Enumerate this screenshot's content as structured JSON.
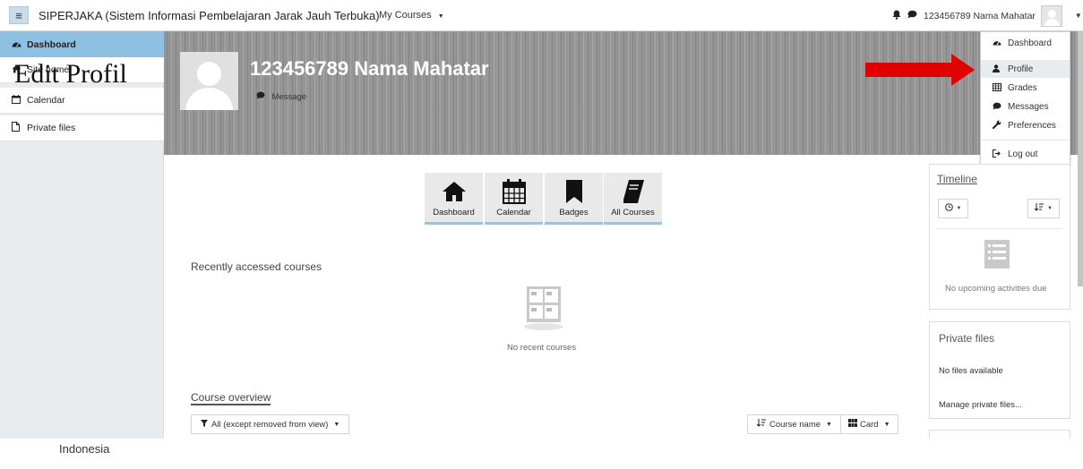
{
  "navbar": {
    "site_name": "SIPERJAKA (Sistem Informasi Pembelajaran Jarak Jauh Terbuka)",
    "my_courses": "My Courses",
    "user_name": "123456789 Nama Mahatar"
  },
  "drawer": {
    "items": [
      {
        "label": "Dashboard",
        "icon": "tachometer-icon",
        "active": true
      },
      {
        "label": "Site home",
        "icon": "home-icon"
      },
      {
        "label": "Calendar",
        "icon": "calendar-icon"
      },
      {
        "label": "Private files",
        "icon": "file-icon"
      }
    ]
  },
  "overlay_title": "Edit Profil",
  "profile": {
    "name": "123456789 Nama Mahatar",
    "message_label": "Message"
  },
  "user_menu": {
    "items": [
      {
        "label": "Dashboard",
        "icon": "tachometer-icon"
      },
      {
        "label": "Profile",
        "icon": "user-icon",
        "highlighted": true
      },
      {
        "label": "Grades",
        "icon": "table-icon"
      },
      {
        "label": "Messages",
        "icon": "comment-icon"
      },
      {
        "label": "Preferences",
        "icon": "wrench-icon"
      },
      {
        "label": "Log out",
        "icon": "sign-out-icon"
      }
    ]
  },
  "tiles": [
    {
      "label": "Dashboard",
      "icon": "home-icon"
    },
    {
      "label": "Calendar",
      "icon": "calendar-icon"
    },
    {
      "label": "Badges",
      "icon": "bookmark-icon"
    },
    {
      "label": "All Courses",
      "icon": "book-icon"
    }
  ],
  "recent": {
    "title": "Recently accessed courses",
    "empty_text": "No recent courses"
  },
  "overview": {
    "title": "Course overview",
    "filter_label": "All (except removed from view)",
    "sort_label": "Course name",
    "view_label": "Card"
  },
  "timeline": {
    "title": "Timeline",
    "empty_text": "No upcoming activities due"
  },
  "private_files": {
    "title": "Private files",
    "empty_text": "No files available",
    "manage_link": "Manage private files..."
  },
  "footer": {
    "text": "Indonesia"
  },
  "colors": {
    "drawer_bg": "#e9ecef",
    "active_item": "#8ec0e1",
    "arrow": "#e00000",
    "tile_accent": "#9fc3dc"
  }
}
